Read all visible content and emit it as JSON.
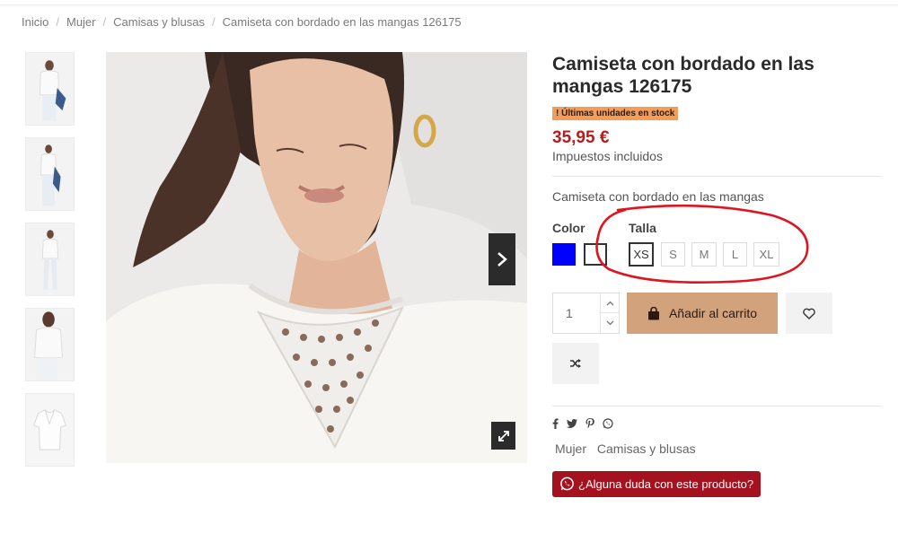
{
  "breadcrumb": [
    "Inicio",
    "Mujer",
    "Camisas y blusas",
    "Camiseta con bordado en las mangas 126175"
  ],
  "product": {
    "title": "Camiseta con bordado en las mangas 126175",
    "stock_badge": "! Últimas unidades en stock",
    "price": "35,95 €",
    "tax_note": "Impuestos incluidos",
    "short_description": "Camiseta con bordado en las mangas"
  },
  "color": {
    "label": "Color",
    "options": [
      {
        "name": "blue",
        "hex": "#0000ff"
      },
      {
        "name": "white",
        "hex": "#ffffff",
        "selected": true
      }
    ]
  },
  "size": {
    "label": "Talla",
    "options": [
      "XS",
      "S",
      "M",
      "L",
      "XL"
    ],
    "selected": "XS"
  },
  "quantity": {
    "value": "1"
  },
  "actions": {
    "add_to_cart": "Añadir al carrito"
  },
  "tags": [
    "Mujer",
    "Camisas y blusas"
  ],
  "whatsapp": {
    "label": "¿Alguna duda con este producto?"
  },
  "colors": {
    "price": "#b91b1b",
    "stock_badge": "#f39d58",
    "add_to_cart": "#d2a27c",
    "whatsapp": "#a3121e",
    "annotation": "#e0141e"
  },
  "icons": [
    "chevron-right-icon",
    "expand-icon",
    "chevron-up-icon",
    "chevron-down-icon",
    "shopping-bag-icon",
    "heart-icon",
    "shuffle-icon",
    "facebook-icon",
    "twitter-icon",
    "pinterest-icon",
    "whatsapp-icon"
  ]
}
